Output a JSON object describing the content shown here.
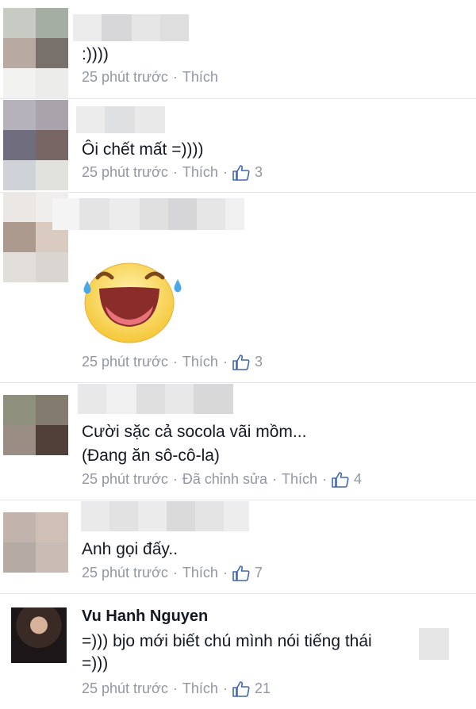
{
  "comments": [
    {
      "text": ":))))",
      "time": "25 phút trước",
      "like_label": "Thích",
      "likes": ""
    },
    {
      "text": "Ôi chết mất =))))",
      "time": "25 phút trước",
      "like_label": "Thích",
      "likes": "3"
    },
    {
      "text": "",
      "time": "25 phút trước",
      "like_label": "Thích",
      "likes": "3",
      "sticker": "laughing-with-tears-sticker"
    },
    {
      "text": "Cười sặc cả socola vãi mồm...",
      "text2": "(Đang ăn sô-cô-la)",
      "time": "25 phút trước",
      "edited": "Đã chỉnh sửa",
      "like_label": "Thích",
      "likes": "4"
    },
    {
      "text": "Anh gọi đấy..",
      "time": "25 phút trước",
      "like_label": "Thích",
      "likes": "7"
    },
    {
      "name": "Vu Hanh Nguyen",
      "text": "=))) bjo mới biết chú mình nói tiếng thái",
      "text2": "=)))",
      "time": "25 phút trước",
      "like_label": "Thích",
      "likes": "21"
    }
  ],
  "icons": {
    "like": "thumbs-up-icon"
  },
  "colors": {
    "meta": "#9197a3",
    "like": "#4267b2",
    "divider": "#e3e5e9"
  }
}
